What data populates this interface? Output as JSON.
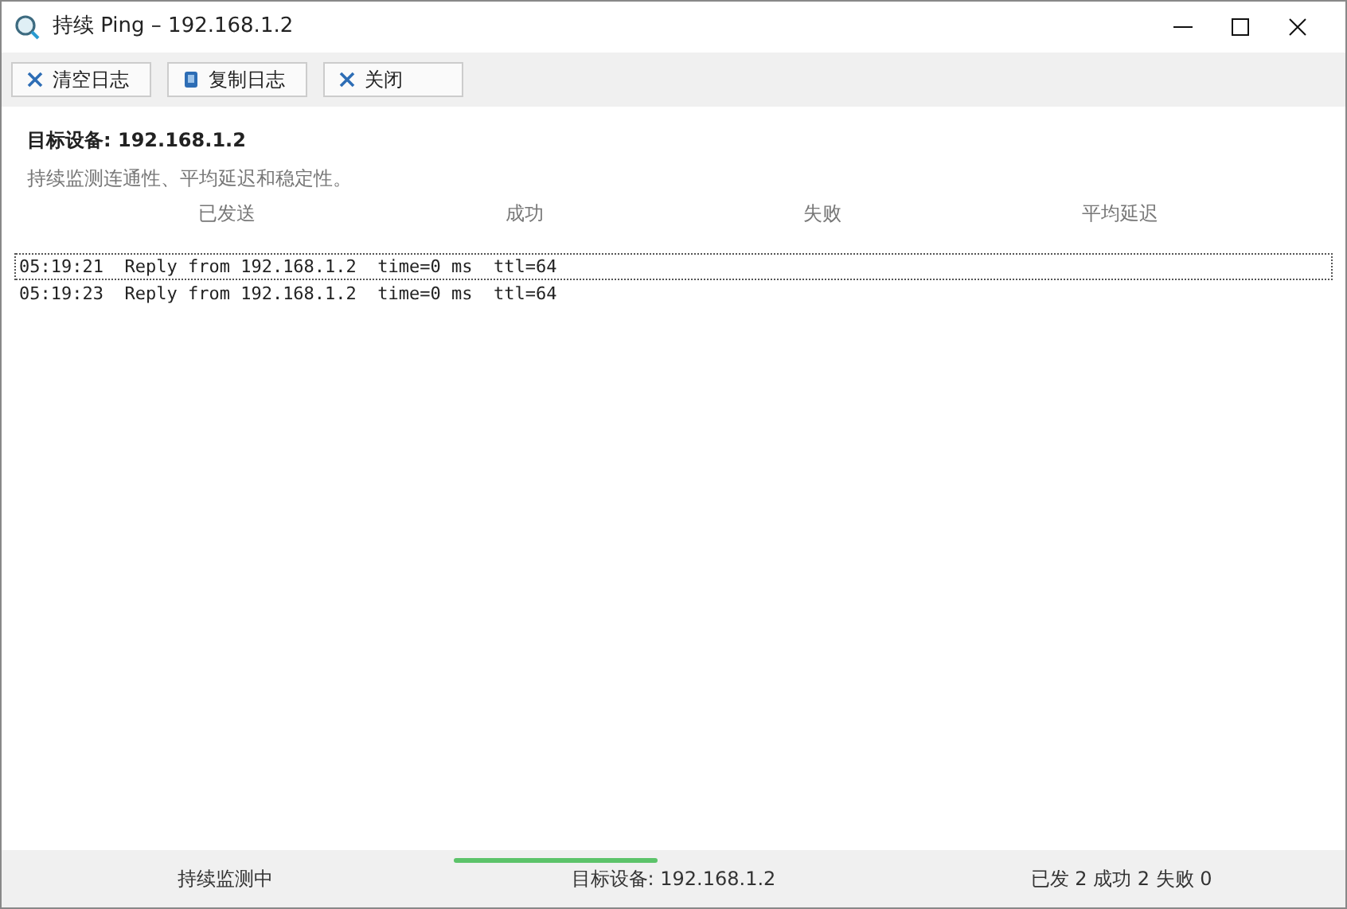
{
  "window": {
    "title": "持续 Ping – 192.168.1.2"
  },
  "toolbar": [
    {
      "kind": "clear",
      "label": "清空日志"
    },
    {
      "kind": "copy",
      "label": "复制日志"
    },
    {
      "kind": "close",
      "label": "关闭"
    }
  ],
  "target": {
    "title": "目标设备: 192.168.1.2",
    "description": "持续监测连通性、平均延迟和稳定性。"
  },
  "stats_columns": [
    "已发送",
    "成功",
    "失败",
    "平均延迟"
  ],
  "log": [
    {
      "text": "05:19:21  Reply from 192.168.1.2  time=0 ms  ttl=64",
      "selected": true
    },
    {
      "text": "05:19:23  Reply from 192.168.1.2  time=0 ms  ttl=64",
      "selected": false
    }
  ],
  "status_bar": {
    "state": "持续监测中",
    "busy": true,
    "target": "目标设备: 192.168.1.2",
    "counts": "已发 2  成功 2  失败 0"
  }
}
